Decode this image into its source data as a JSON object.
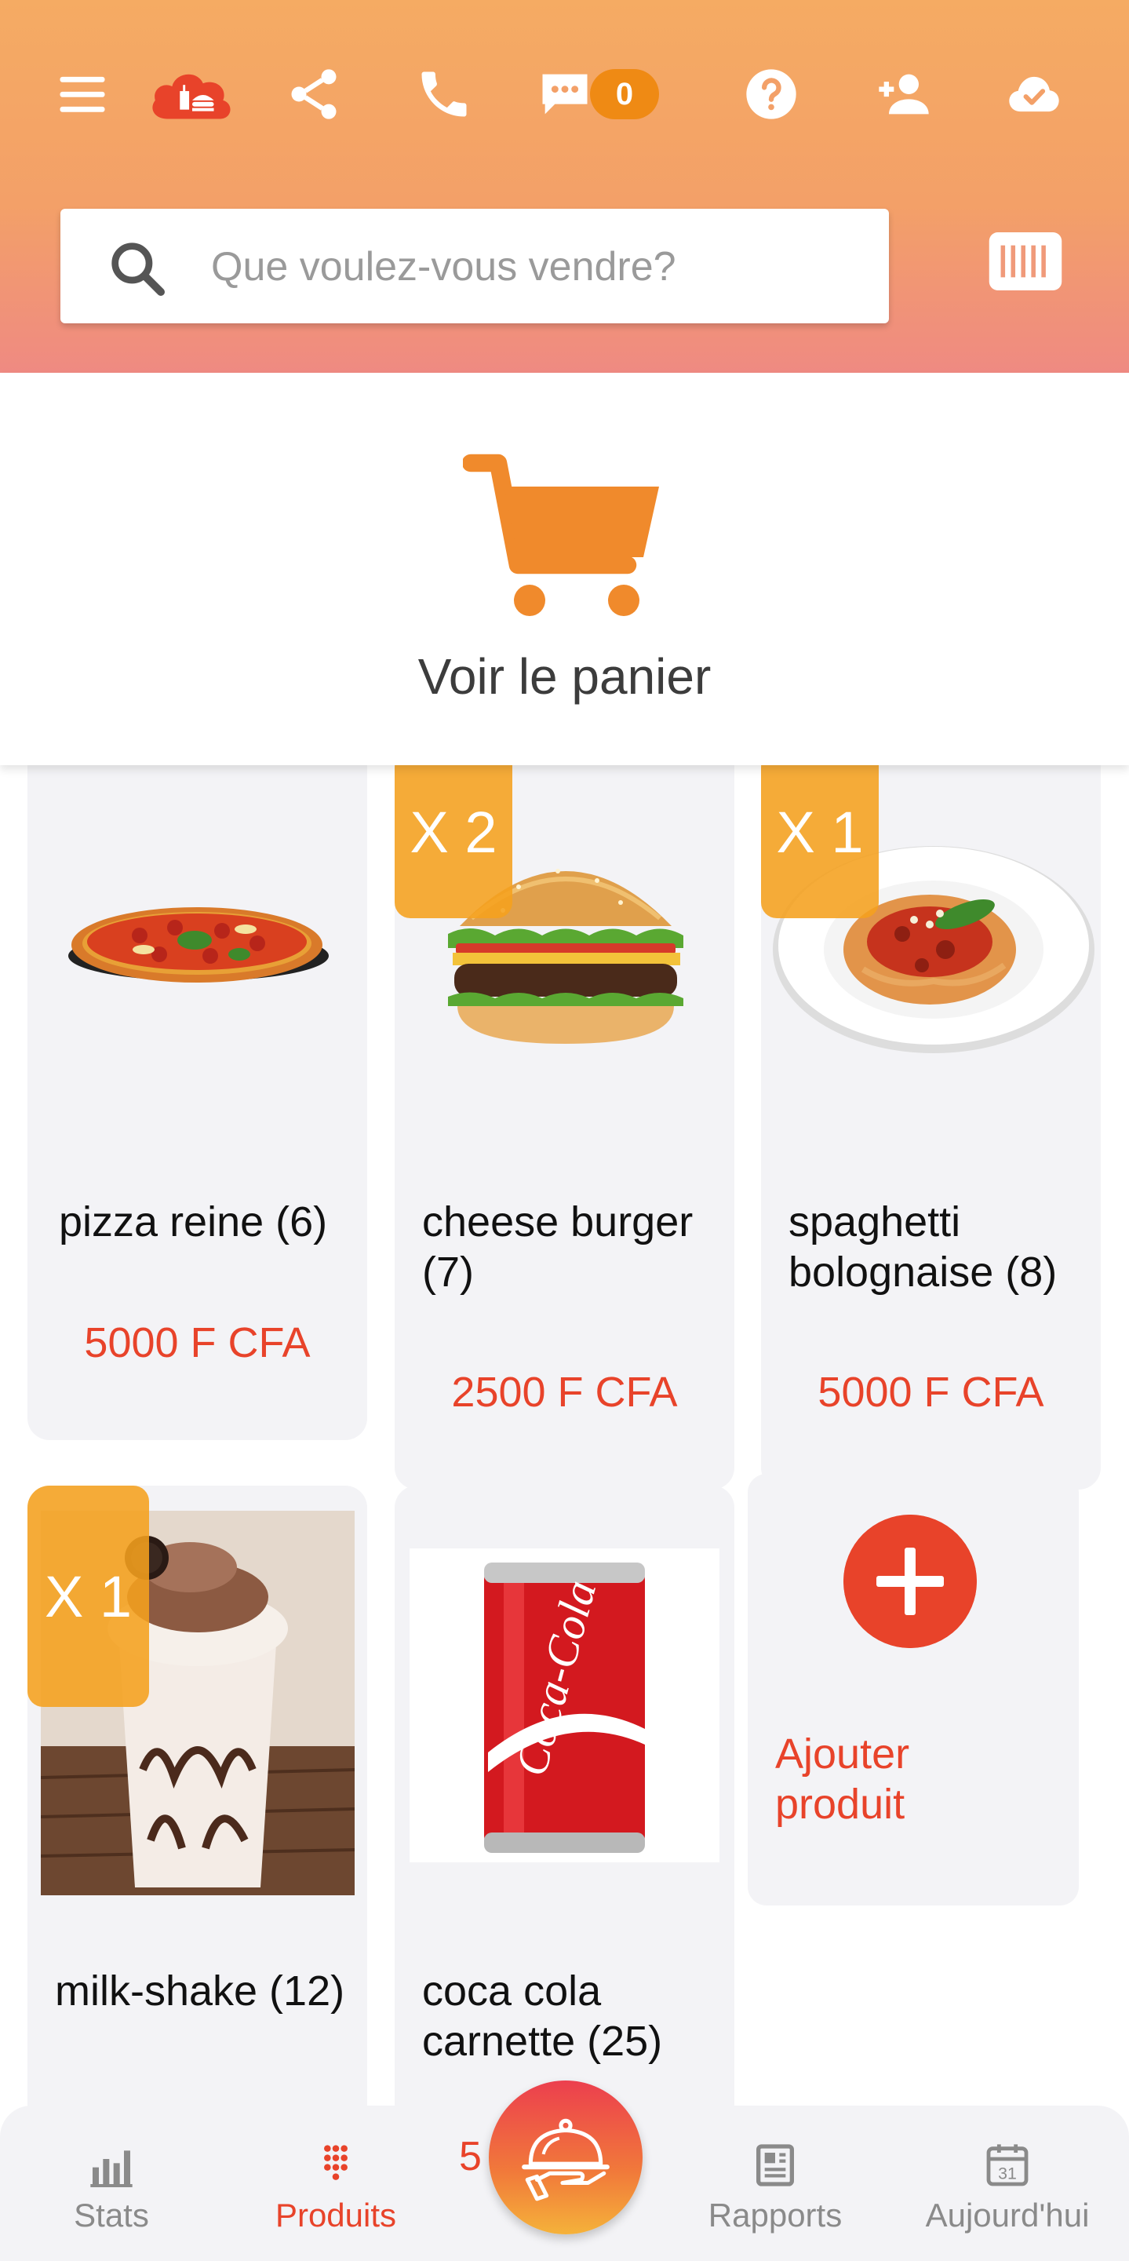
{
  "header": {
    "messages_count": "0",
    "search_placeholder": "Que voulez-vous vendre?",
    "colors": {
      "gradient_top": "#f5ab63",
      "gradient_bottom": "#ef8a82",
      "logo_red": "#e8432a"
    },
    "icons": [
      "menu-icon",
      "app-logo-cloud-food-icon",
      "share-icon",
      "phone-icon",
      "chat-icon",
      "help-icon",
      "add-user-icon",
      "cloud-check-icon",
      "barcode-icon"
    ]
  },
  "cart": {
    "label": "Voir le panier",
    "color": "#f08a2c"
  },
  "products": [
    {
      "name": "pizza reine (6)",
      "price": "5000 F CFA",
      "qty": "",
      "image": "pizza-image"
    },
    {
      "name": "cheese burger (7)",
      "price": "2500 F CFA",
      "qty": "X 2",
      "image": "burger-image"
    },
    {
      "name": "spaghetti bolognaise (8)",
      "price": "5000 F CFA",
      "qty": "X 1",
      "image": "spaghetti-image"
    },
    {
      "name": "milk-shake (12)",
      "price": "",
      "qty": "X 1",
      "image": "milkshake-image"
    },
    {
      "name": "coca cola carnette (25)",
      "price": "",
      "qty": "",
      "image": "coca-cola-image"
    }
  ],
  "add_product": {
    "label": "Ajouter produit"
  },
  "bottom_nav": {
    "stats": "Stats",
    "produits": "Produits",
    "rapports": "Rapports",
    "aujourdhui": "Aujourd'hui",
    "total_partial": "5            A",
    "calendar_day": "31",
    "active_color": "#e8432a",
    "inactive_color": "#8a8a8a"
  }
}
